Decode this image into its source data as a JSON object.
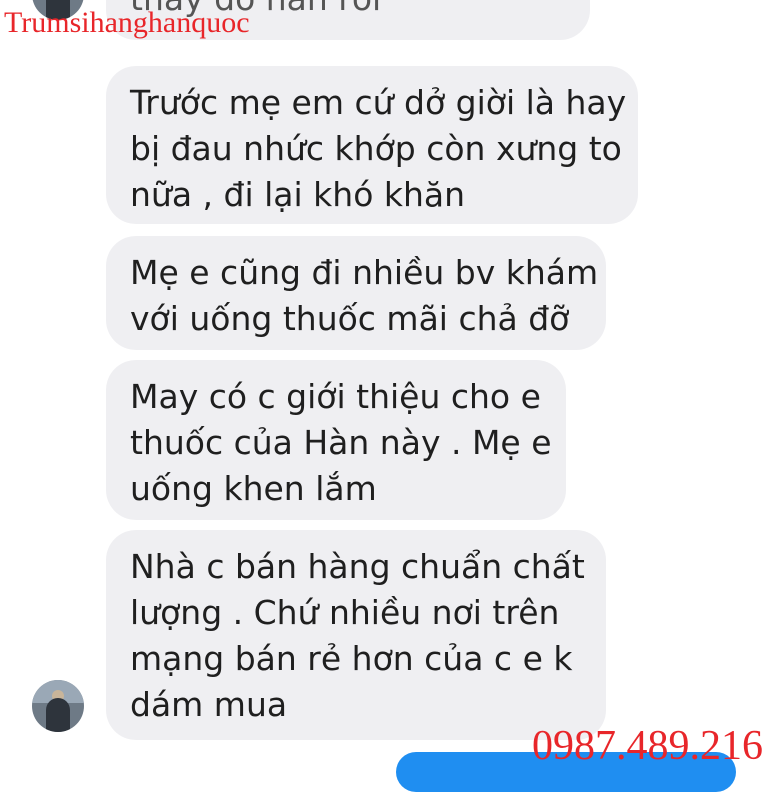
{
  "watermark": {
    "brand": "Trumsihanghanquoc",
    "phone": "0987.489.216",
    "color": "#e8262a"
  },
  "messages": [
    {
      "lines": [
        "thay đỡ hẳn rồi"
      ]
    },
    {
      "lines": [
        "Trước mẹ em cứ dở giời là hay",
        "bị đau nhức khớp còn xưng to",
        "nữa , đi lại khó khăn"
      ]
    },
    {
      "lines": [
        "Mẹ e cũng đi nhiều bv khám",
        "với uống thuốc mãi chả đỡ"
      ]
    },
    {
      "lines": [
        "May có c giới thiệu cho e",
        "thuốc của Hàn này . Mẹ e",
        "uống khen lắm"
      ]
    },
    {
      "lines": [
        "Nhà c bán hàng chuẩn chất",
        "lượng . Chứ nhiều nơi trên",
        "mạng bán rẻ hơn của c e k",
        "dám mua"
      ]
    }
  ],
  "colors": {
    "incoming_bubble": "#efeff2",
    "outgoing_bubble": "#1f8ef1",
    "background": "#ffffff"
  },
  "icons": [
    "avatar"
  ]
}
